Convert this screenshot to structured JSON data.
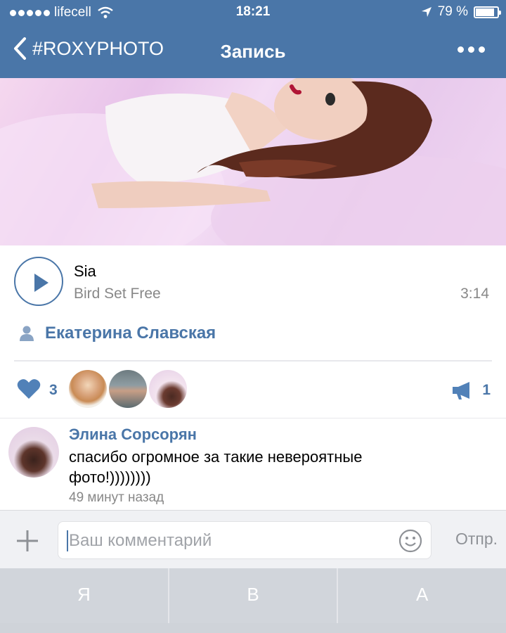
{
  "status_bar": {
    "carrier": "lifecell",
    "time": "18:21",
    "battery": "79 %",
    "battery_level": 0.79
  },
  "nav": {
    "back_label": "#ROXYPHOTO",
    "title": "Запись"
  },
  "audio": {
    "artist": "Sia",
    "track": "Bird Set Free",
    "duration": "3:14"
  },
  "author": {
    "name": "Екатерина Славская"
  },
  "likes": {
    "count": "3",
    "reposts": "1"
  },
  "comment": {
    "author": "Элина Сорсорян",
    "text": "спасибо огромное за такие невероятные фото!))))))))",
    "time": "49 минут назад"
  },
  "input": {
    "placeholder": "Ваш комментарий",
    "send_label": "Отпр."
  },
  "keyboard": {
    "suggestions": [
      "Я",
      "В",
      "А"
    ]
  },
  "colors": {
    "accent": "#4a76a8",
    "secondary_text": "#888888"
  }
}
